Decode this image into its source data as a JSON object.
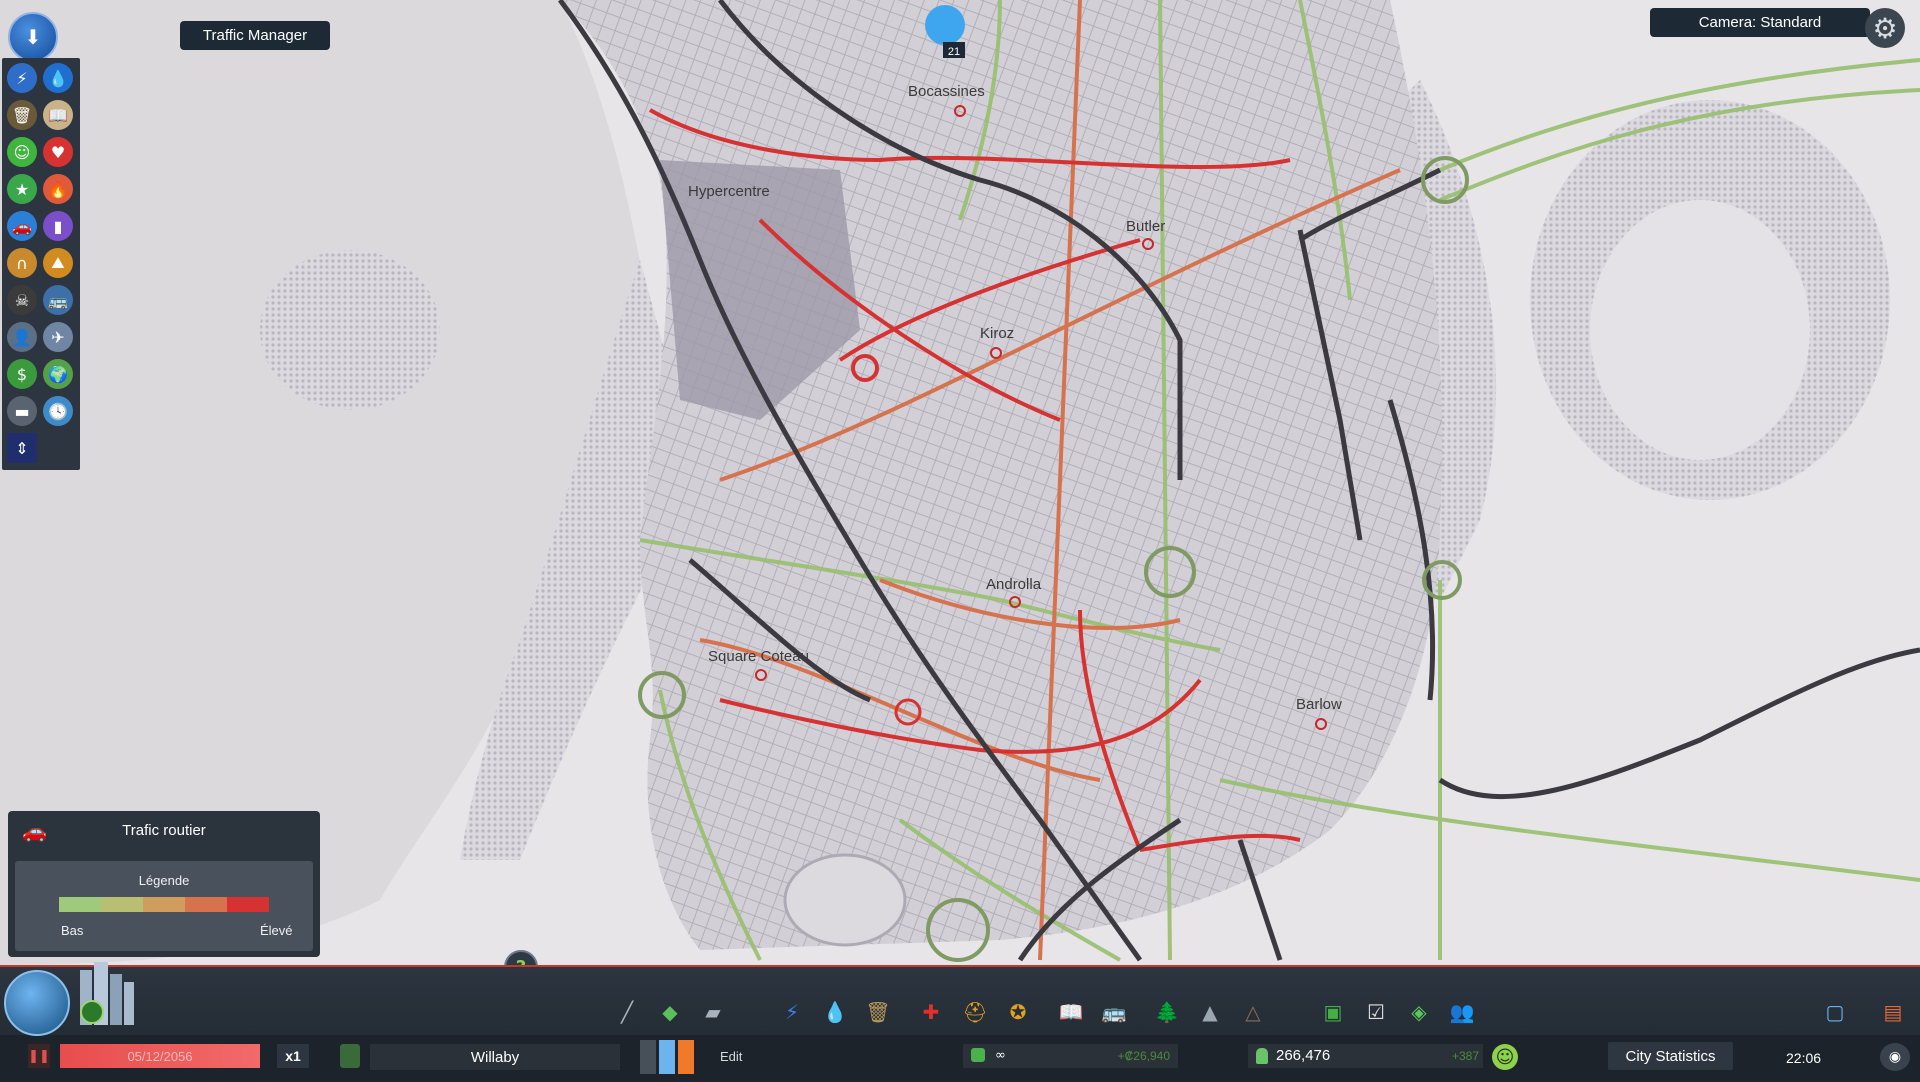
{
  "top": {
    "traffic_manager_label": "Traffic Manager",
    "camera_label": "Camera: Standard",
    "notification_count": "21"
  },
  "map": {
    "districts": [
      "Bocassines",
      "Hypercentre",
      "Butler",
      "Kiroz",
      "Androlla",
      "Square Coteau",
      "Barlow"
    ]
  },
  "legend": {
    "title": "Trafic routier",
    "subtitle": "Légende",
    "low_label": "Bas",
    "high_label": "Élevé",
    "colors": [
      "#9fca7c",
      "#b8bf72",
      "#cf9e5e",
      "#d6734e",
      "#d63232"
    ]
  },
  "status": {
    "date": "05/12/2056",
    "speed": "x1",
    "city_name": "Willaby",
    "edit_label": "Edit",
    "money": "∞",
    "income": "+₡26,940",
    "population": "266,476",
    "population_change": "+387",
    "stats_button": "City Statistics",
    "time": "22:06"
  },
  "icons": {
    "left_toolbar": [
      "electricity-icon",
      "water-icon",
      "garbage-icon",
      "education-icon",
      "happiness-icon",
      "health-icon",
      "leisure-icon",
      "fire-icon",
      "traffic-icon",
      "noise-icon",
      "police-icon",
      "natural-resources-icon",
      "crime-icon",
      "public-transport-icon",
      "population-icon",
      "transport-routes-icon",
      "land-value-icon",
      "wind-icon",
      "heating-icon",
      "time-icon",
      "traffic-manager-icon"
    ],
    "bottom_toolbar": [
      "roads-icon",
      "zoning-icon",
      "districts-icon",
      "electricity-icon",
      "water-icon",
      "garbage-icon",
      "healthcare-icon",
      "fire-icon",
      "police-icon",
      "education-icon",
      "public-transport-icon",
      "parks-icon",
      "unique-buildings-icon",
      "monuments-icon",
      "economy-icon",
      "policies-icon",
      "areas-icon",
      "citizens-icon"
    ]
  }
}
